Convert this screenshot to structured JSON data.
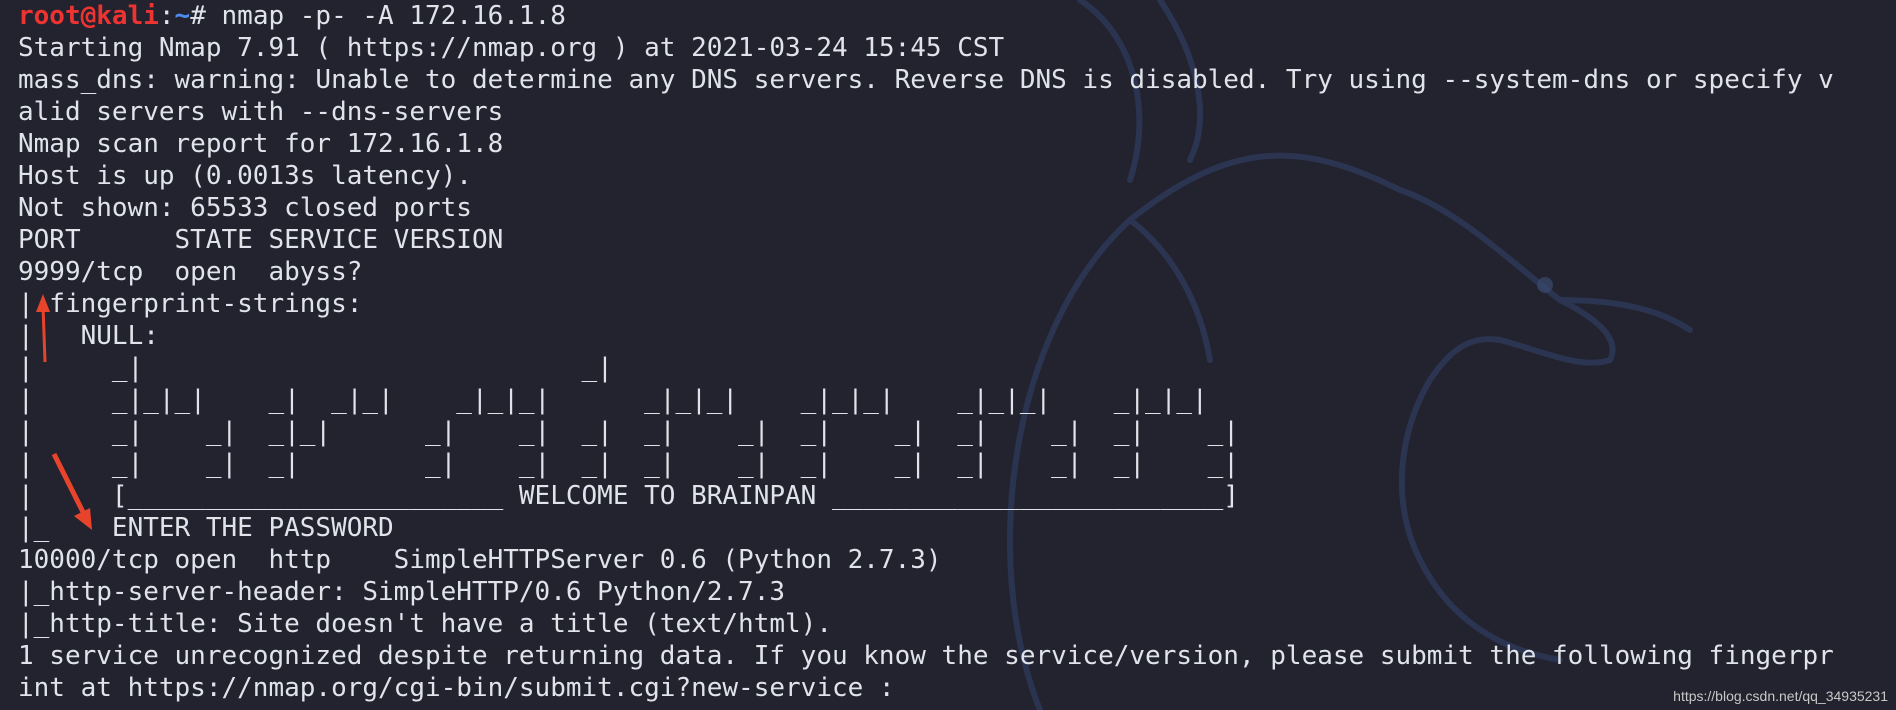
{
  "prompt": {
    "user_host": "root@kali",
    "colon": ":",
    "path": "~",
    "hash": "# ",
    "command": "nmap -p- -A 172.16.1.8"
  },
  "output_lines": [
    "Starting Nmap 7.91 ( https://nmap.org ) at 2021-03-24 15:45 CST",
    "mass_dns: warning: Unable to determine any DNS servers. Reverse DNS is disabled. Try using --system-dns or specify v",
    "alid servers with --dns-servers",
    "Nmap scan report for 172.16.1.8",
    "Host is up (0.0013s latency).",
    "Not shown: 65533 closed ports",
    "PORT      STATE SERVICE VERSION",
    "9999/tcp  open  abyss?",
    "| fingerprint-strings:",
    "|   NULL:",
    "|     _|                            _|",
    "|     _|_|_|    _|  _|_|    _|_|_|      _|_|_|    _|_|_|    _|_|_|    _|_|_|",
    "|     _|    _|  _|_|      _|    _|  _|  _|    _|  _|    _|  _|    _|  _|    _|",
    "|     _|    _|  _|        _|    _|  _|  _|    _|  _|    _|  _|    _|  _|    _|",
    "|     [________________________ WELCOME TO BRAINPAN _________________________]",
    "|_    ENTER THE PASSWORD",
    "10000/tcp open  http    SimpleHTTPServer 0.6 (Python 2.7.3)",
    "|_http-server-header: SimpleHTTP/0.6 Python/2.7.3",
    "|_http-title: Site doesn't have a title (text/html).",
    "1 service unrecognized despite returning data. If you know the service/version, please submit the following fingerpr",
    "int at https://nmap.org/cgi-bin/submit.cgi?new-service :"
  ],
  "watermark": "https://blog.csdn.net/qq_34935231",
  "colors": {
    "background": "#22232e",
    "text": "#e1e3ea",
    "prompt_user": "#ee3333",
    "prompt_path": "#4c8df2",
    "annotation_arrow": "#e8442c"
  }
}
